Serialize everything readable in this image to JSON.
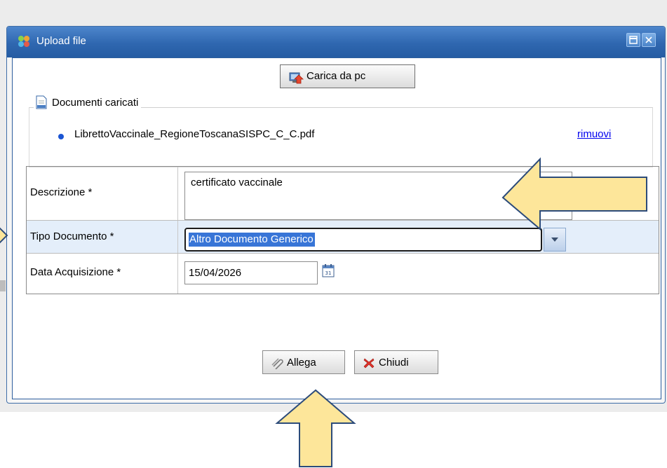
{
  "window": {
    "title": "Upload file",
    "icons": {
      "app": "app-logo-icon",
      "maximize": "maximize-icon",
      "close": "close-icon"
    }
  },
  "upload": {
    "button_label": "Carica da pc",
    "button_icon": "upload-from-pc-icon"
  },
  "uploaded": {
    "legend": "Documenti caricati",
    "legend_icon": "document-icon",
    "files": [
      {
        "name": "LibrettoVaccinale_RegioneToscanaSISPC_C_C.pdf",
        "action": "rimuovi"
      }
    ]
  },
  "form": {
    "description": {
      "label": "Descrizione *",
      "value": "certificato vaccinale"
    },
    "doc_type": {
      "label": "Tipo Documento *",
      "value": "Altro Documento Generico"
    },
    "acq_date": {
      "label": "Data Acquisizione *",
      "value": "15/04/2026",
      "icon": "calendar-icon"
    }
  },
  "actions": {
    "attach": {
      "label": "Allega",
      "icon": "paperclip-icon"
    },
    "close": {
      "label": "Chiudi",
      "icon": "red-x-icon"
    }
  },
  "colors": {
    "titlebar": "#2f67b0",
    "selection": "#3875d7",
    "highlight_row": "#e4eefa",
    "annotation_arrow": "#fde69a"
  }
}
